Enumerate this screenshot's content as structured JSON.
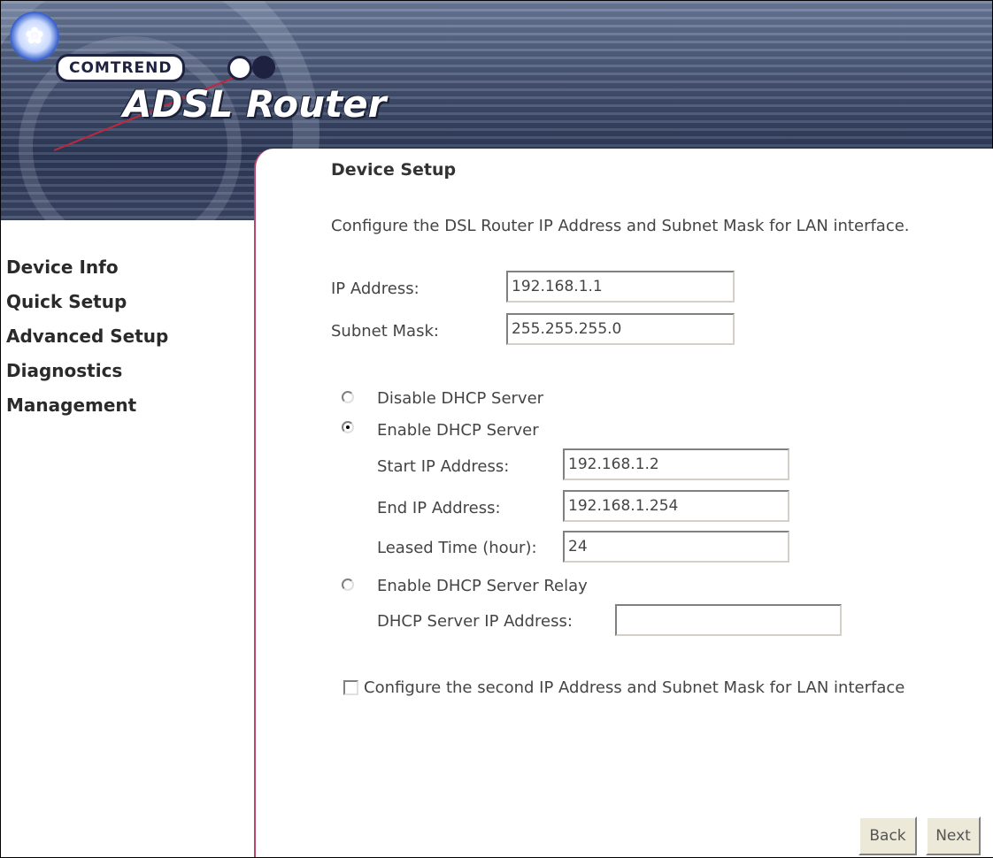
{
  "header": {
    "brand": "COMTREND",
    "product": "ADSL Router"
  },
  "menu": [
    {
      "label": "Device Info"
    },
    {
      "label": "Quick Setup"
    },
    {
      "label": "Advanced Setup"
    },
    {
      "label": "Diagnostics"
    },
    {
      "label": "Management"
    }
  ],
  "page": {
    "title": "Device Setup",
    "description": "Configure the DSL Router IP Address and Subnet Mask for LAN interface."
  },
  "lan": {
    "ip_label": "IP Address:",
    "ip_value": "192.168.1.1",
    "mask_label": "Subnet Mask:",
    "mask_value": "255.255.255.0"
  },
  "dhcp": {
    "disable_label": "Disable DHCP Server",
    "enable_label": "Enable DHCP Server",
    "relay_label": "Enable DHCP Server Relay",
    "selected": "enable",
    "start_label": "Start IP Address:",
    "start_value": "192.168.1.2",
    "end_label": "End IP Address:",
    "end_value": "192.168.1.254",
    "lease_label": "Leased Time (hour):",
    "lease_value": "24",
    "relay_ip_label": "DHCP Server IP Address:",
    "relay_ip_value": ""
  },
  "second_ip": {
    "label": "Configure the second IP Address and Subnet Mask for LAN interface",
    "checked": false
  },
  "buttons": {
    "back": "Back",
    "next": "Next"
  },
  "colors": {
    "panel_border": "#b8446a",
    "banner": "#4a5878"
  }
}
